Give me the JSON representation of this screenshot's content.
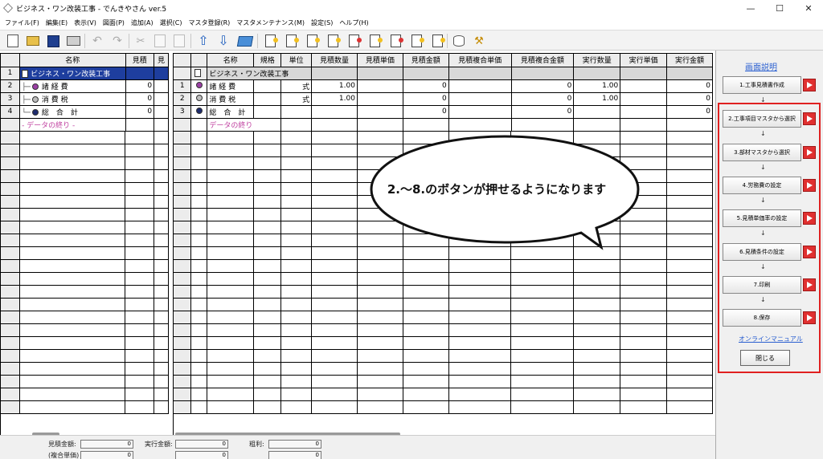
{
  "window": {
    "title": "ビジネス・ワン改装工事 - でんきやさん ver.5",
    "controls": {
      "minimize": "—",
      "maximize": "☐",
      "close": "✕"
    }
  },
  "menu": {
    "items": [
      "ファイル(F)",
      "編集(E)",
      "表示(V)",
      "図面(P)",
      "追加(A)",
      "選択(C)",
      "マスタ登録(R)",
      "マスタメンテナンス(M)",
      "設定(S)",
      "ヘルプ(H)"
    ]
  },
  "left_grid": {
    "headers": [
      "",
      "名称",
      "見積",
      "見"
    ],
    "rows": [
      {
        "num": "1",
        "name": "ビジネス・ワン改装工事",
        "est": ""
      },
      {
        "num": "2",
        "name": "諸 経 費",
        "est": "0"
      },
      {
        "num": "3",
        "name": "消 費 税",
        "est": "0"
      },
      {
        "num": "4",
        "name": "総　合　計",
        "est": "0"
      }
    ],
    "end_text": "- データの終り -"
  },
  "right_grid": {
    "headers": [
      "",
      "",
      "名称",
      "規格",
      "単位",
      "見積数量",
      "見積単価",
      "見積金額",
      "見積複合単価",
      "見積複合金額",
      "実行数量",
      "実行単価",
      "実行金額"
    ],
    "header_row_name": "ビジネス・ワン改装工事",
    "rows": [
      {
        "num": "1",
        "name": "諸 経 費",
        "unit": "式",
        "qty": "1.00",
        "amount": "0",
        "comp_amount": "0",
        "exec_qty": "1.00",
        "exec_amount": "0"
      },
      {
        "num": "2",
        "name": "消 費 税",
        "unit": "式",
        "qty": "1.00",
        "amount": "0",
        "comp_amount": "0",
        "exec_qty": "1.00",
        "exec_amount": "0"
      },
      {
        "num": "3",
        "name": "総　合　計",
        "unit": "",
        "qty": "",
        "amount": "0",
        "comp_amount": "0",
        "exec_qty": "",
        "exec_amount": "0"
      }
    ],
    "end_text": "データの終り"
  },
  "footer": {
    "est_amount_label": "見積金額:",
    "est_amount_value": "0",
    "exec_amount_label": "実行金額:",
    "exec_amount_value": "0",
    "gross_label": "粗利:",
    "gross_value": "0",
    "composite_label": "(複合単価)",
    "composite_value": "0",
    "extra_value_1": "0",
    "extra_value_2": "0"
  },
  "right_panel": {
    "screen_desc_link": "画面説明",
    "buttons": [
      "1.工事見積書作成",
      "2.工事項目マスタから選択",
      "3.部材マスタから選択",
      "4.労務費の設定",
      "5.見積単価率の設定",
      "6.見積条件の設定",
      "7.印刷",
      "8.保存"
    ],
    "arrow": "↓",
    "manual_link": "オンラインマニュアル",
    "close_button": "閉じる"
  },
  "callout": {
    "text": "2.～8.のボタンが押せるようになります"
  },
  "colors": {
    "selection": "#1e3e9e",
    "highlight_border": "#e02020",
    "red_button": "#e03030",
    "link": "#2a5fd0",
    "end_text": "#c040a0"
  },
  "icons": [
    "new-document-icon",
    "open-folder-icon",
    "save-disk-icon",
    "print-icon",
    "undo-icon",
    "redo-icon",
    "cut-icon",
    "copy-icon",
    "paste-icon",
    "move-up-icon",
    "move-down-icon",
    "send-icon",
    "document-icon",
    "database-icon",
    "tool-icon"
  ]
}
